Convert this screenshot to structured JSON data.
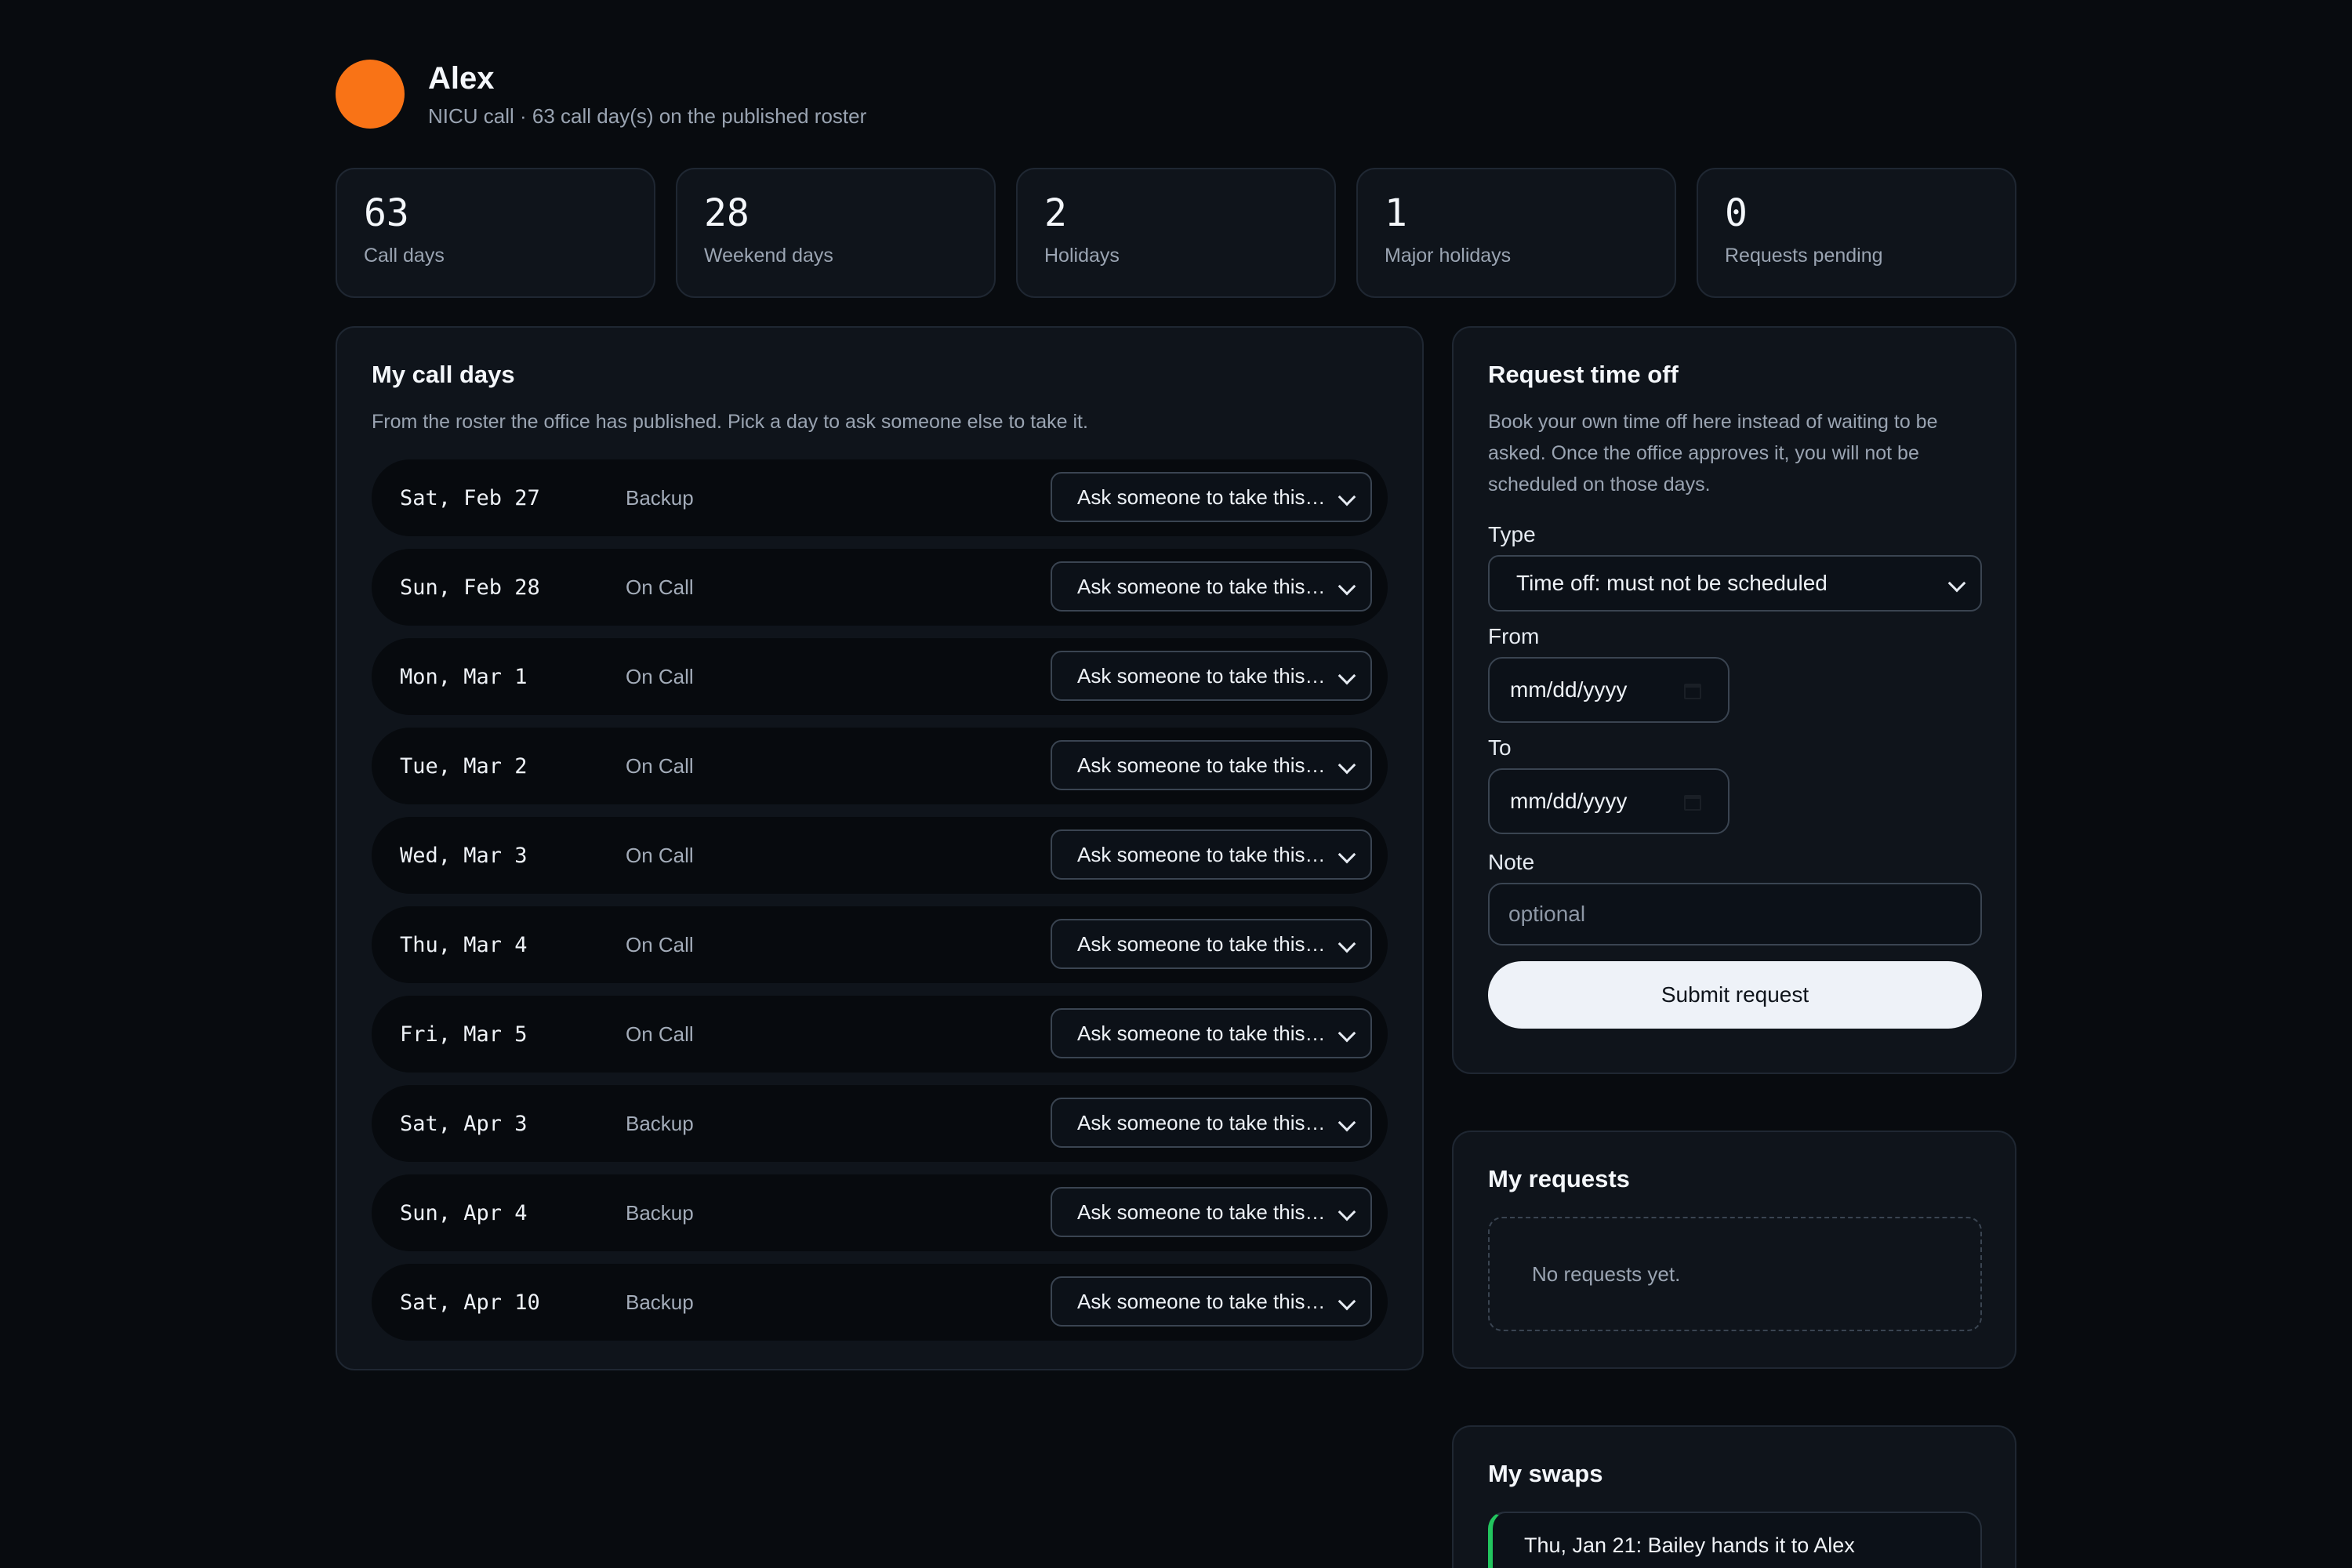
{
  "profile": {
    "name": "Alex",
    "subtitle": "NICU call · 63 call day(s) on the published roster",
    "avatar_color": "#f97316"
  },
  "stats": [
    {
      "value": "63",
      "label": "Call days"
    },
    {
      "value": "28",
      "label": "Weekend days"
    },
    {
      "value": "2",
      "label": "Holidays"
    },
    {
      "value": "1",
      "label": "Major holidays"
    },
    {
      "value": "0",
      "label": "Requests pending"
    }
  ],
  "call_days": {
    "title": "My call days",
    "description": "From the roster the office has published. Pick a day to ask someone else to take it.",
    "swap_select_label": "Ask someone to take this…",
    "rows": [
      {
        "date": "Sat, Feb 27",
        "role": "Backup"
      },
      {
        "date": "Sun, Feb 28",
        "role": "On Call"
      },
      {
        "date": "Mon, Mar 1",
        "role": "On Call"
      },
      {
        "date": "Tue, Mar 2",
        "role": "On Call"
      },
      {
        "date": "Wed, Mar 3",
        "role": "On Call"
      },
      {
        "date": "Thu, Mar 4",
        "role": "On Call"
      },
      {
        "date": "Fri, Mar 5",
        "role": "On Call"
      },
      {
        "date": "Sat, Apr 3",
        "role": "Backup"
      },
      {
        "date": "Sun, Apr 4",
        "role": "Backup"
      },
      {
        "date": "Sat, Apr 10",
        "role": "Backup"
      }
    ]
  },
  "request_time_off": {
    "title": "Request time off",
    "description": "Book your own time off here instead of waiting to be asked. Once the office approves it, you will not be scheduled on those days.",
    "type_label": "Type",
    "type_value": "Time off: must not be scheduled",
    "from_label": "From",
    "from_value": "mm/dd/yyyy",
    "to_label": "To",
    "to_value": "mm/dd/yyyy",
    "note_label": "Note",
    "note_placeholder": "optional",
    "submit_label": "Submit request"
  },
  "my_requests": {
    "title": "My requests",
    "empty_text": "No requests yet."
  },
  "my_swaps": {
    "title": "My swaps",
    "items": [
      {
        "text": "Thu, Jan 21: Bailey hands it to Alex",
        "accent": "#22c55e"
      }
    ]
  }
}
